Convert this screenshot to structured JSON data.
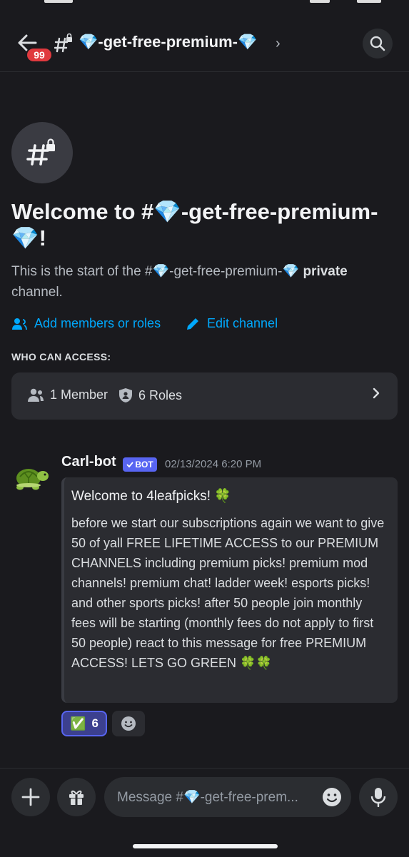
{
  "header": {
    "badge_count": "99",
    "channel_name": "💎-get-free-premium-💎",
    "chevron": "›"
  },
  "intro": {
    "title": "Welcome to #💎-get-free-premium-💎!",
    "text_start": "This is the start of the #💎-get-free-premium-💎 ",
    "text_bold": "private",
    "text_end": " channel.",
    "add_members_label": "Add members or roles",
    "edit_channel_label": "Edit channel",
    "who_can_access_label": "WHO CAN ACCESS:",
    "members_label": "1 Member",
    "roles_label": "6 Roles"
  },
  "message": {
    "author": "Carl-bot",
    "bot_tag": "BOT",
    "timestamp": "02/13/2024 6:20 PM",
    "embed_title": "Welcome to 4leafpicks! 🍀",
    "embed_body": "before we start our subscriptions again we want to give 50 of yall FREE LIFETIME ACCESS to our PREMIUM CHANNELS including premium picks! premium mod channels! premium chat! ladder week! esports picks! and other sports picks! after 50 people join monthly fees will be starting (monthly fees do not apply to first 50 people) react to this message for free PREMIUM ACCESS! LETS GO GREEN 🍀🍀",
    "reaction_emoji": "✅",
    "reaction_count": "6"
  },
  "composer": {
    "placeholder": "Message #💎-get-free-prem..."
  },
  "colors": {
    "background": "#1a1a1e",
    "link": "#00a8fc",
    "badge": "#e0393e",
    "bot_tag": "#5865f2"
  },
  "icons": [
    "back-arrow-icon",
    "locked-hash-icon",
    "search-icon",
    "people-icon",
    "pencil-icon",
    "shield-icon",
    "chevron-right-icon",
    "turtle-avatar",
    "add-icon",
    "gift-icon",
    "emoji-icon",
    "microphone-icon"
  ]
}
